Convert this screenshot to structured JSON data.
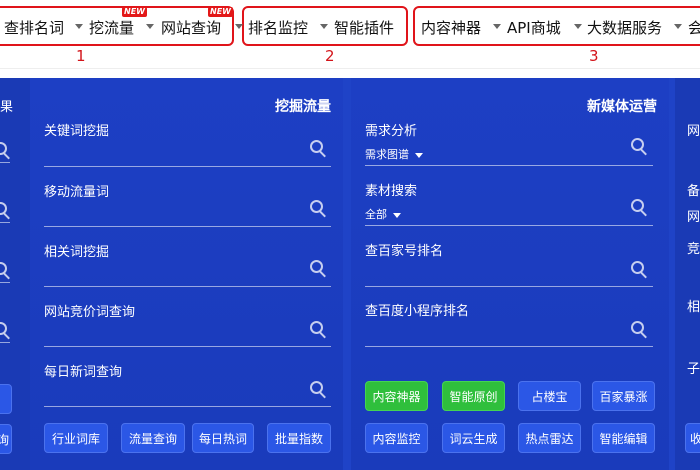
{
  "nav": {
    "new_badge": "NEW",
    "group1": {
      "number": "1",
      "items": [
        "查排名词",
        "挖流量",
        "网站查询"
      ]
    },
    "group2": {
      "number": "2",
      "items": [
        "排名监控",
        "智能插件"
      ]
    },
    "group3": {
      "number": "3",
      "items": [
        "内容神器",
        "API商城",
        "大数据服务",
        "会"
      ]
    }
  },
  "left_edge": {
    "top_text": "果",
    "btn1": "",
    "btn2": "询"
  },
  "panel_dig": {
    "title": "挖掘流量",
    "fields": [
      "关键词挖掘",
      "移动流量词",
      "相关词挖掘",
      "网站竞价词查询",
      "每日新词查询"
    ],
    "buttons": [
      "行业词库",
      "流量查询",
      "每日热词",
      "批量指数"
    ]
  },
  "panel_media": {
    "title": "新媒体运营",
    "fields": [
      {
        "label": "需求分析",
        "sub": "需求图谱"
      },
      {
        "label": "素材搜索",
        "sub": "全部"
      },
      {
        "label": "查百家号排名",
        "sub": ""
      },
      {
        "label": "查百度小程序排名",
        "sub": ""
      }
    ],
    "buttons_row1": [
      "内容神器",
      "智能原创",
      "占楼宝",
      "百家暴涨"
    ],
    "buttons_row2": [
      "内容监控",
      "词云生成",
      "热点雷达",
      "智能编辑"
    ]
  },
  "right_edge": {
    "items": [
      "网",
      "备",
      "网",
      "竞",
      "相",
      "子",
      "收"
    ]
  },
  "colors": {
    "accent_red": "#e0141a",
    "band_blue": "#1f43c7",
    "button_green": "#2fbf3c"
  }
}
